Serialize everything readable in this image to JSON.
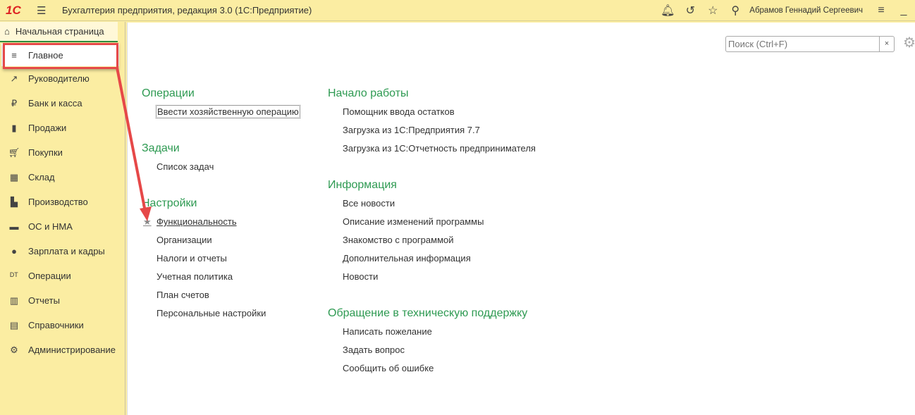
{
  "app": {
    "logo": "1С",
    "title": "Бухгалтерия предприятия, редакция 3.0  (1С:Предприятие)",
    "user": "Абрамов Геннадий Сергеевич"
  },
  "sidebar": {
    "home_tab": "Начальная страница",
    "items": [
      {
        "label": "Главное",
        "icon": "menu-icon"
      },
      {
        "label": "Руководителю",
        "icon": "trend-icon"
      },
      {
        "label": "Банк и касса",
        "icon": "ruble-icon"
      },
      {
        "label": "Продажи",
        "icon": "bag-icon"
      },
      {
        "label": "Покупки",
        "icon": "cart-icon"
      },
      {
        "label": "Склад",
        "icon": "warehouse-icon"
      },
      {
        "label": "Производство",
        "icon": "factory-icon"
      },
      {
        "label": "ОС и НМА",
        "icon": "truck-icon"
      },
      {
        "label": "Зарплата и кадры",
        "icon": "person-icon"
      },
      {
        "label": "Операции",
        "icon": "dt-kt-icon"
      },
      {
        "label": "Отчеты",
        "icon": "bar-chart-icon"
      },
      {
        "label": "Справочники",
        "icon": "books-icon"
      },
      {
        "label": "Администрирование",
        "icon": "gear-icon"
      }
    ]
  },
  "search": {
    "placeholder": "Поиск (Ctrl+F)",
    "clear": "×"
  },
  "left_col": {
    "sections": [
      {
        "title": "Операции",
        "links": [
          "Ввести хозяйственную операцию"
        ]
      },
      {
        "title": "Задачи",
        "links": [
          "Список задач"
        ]
      },
      {
        "title": "Настройки",
        "links": [
          "Функциональность",
          "Организации",
          "Налоги и отчеты",
          "Учетная политика",
          "План счетов",
          "Персональные настройки"
        ]
      }
    ]
  },
  "right_col": {
    "sections": [
      {
        "title": "Начало работы",
        "links": [
          "Помощник ввода остатков",
          "Загрузка из 1С:Предприятия 7.7",
          "Загрузка из 1С:Отчетность предпринимателя"
        ]
      },
      {
        "title": "Информация",
        "links": [
          "Все новости",
          "Описание изменений программы",
          "Знакомство с программой",
          "Дополнительная информация",
          "Новости"
        ]
      },
      {
        "title": "Обращение в техническую поддержку",
        "links": [
          "Написать пожелание",
          "Задать вопрос",
          "Сообщить об ошибке"
        ]
      }
    ]
  },
  "colors": {
    "accent": "#2e9a52",
    "sidebar": "#fbeda2",
    "highlight": "#e64848"
  }
}
